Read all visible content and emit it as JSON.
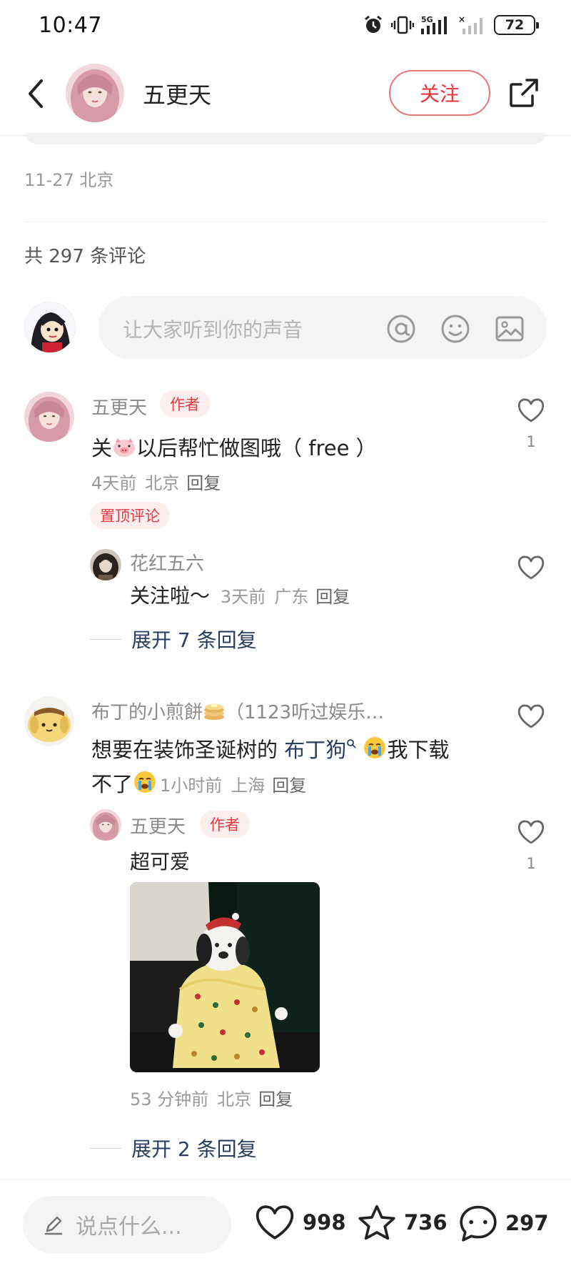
{
  "status_bar": {
    "time": "10:47",
    "battery": "72",
    "network": "5G"
  },
  "nav": {
    "title": "五更天",
    "follow_label": "关注"
  },
  "post": {
    "meta": "11-27 北京",
    "comment_count": "共 297 条评论"
  },
  "input": {
    "placeholder": "让大家听到你的声音"
  },
  "comments": [
    {
      "name": "五更天",
      "tag": "作者",
      "text_a": "关",
      "text_b": "以后帮忙做图哦（ free ）",
      "time": "4天前",
      "location": "北京",
      "reply": "回复",
      "pin_label": "置顶评论",
      "likes": "1",
      "replies": [
        {
          "name": "花红五六",
          "text": "关注啦～",
          "time": "3天前",
          "location": "广东",
          "reply": "回复"
        }
      ],
      "expand_label": "展开 7 条回复"
    },
    {
      "name": "布丁的小煎餅",
      "name_suffix": "（1123听过娱乐…",
      "text_a": "想要在装饰圣诞树的 ",
      "link": "布丁狗",
      "text_b": "我下载",
      "text_c": "不了",
      "time": "1小时前",
      "location": "上海",
      "reply": "回复",
      "replies": [
        {
          "name": "五更天",
          "tag": "作者",
          "text": "超可爱",
          "time": "53 分钟前",
          "location": "北京",
          "reply": "回复",
          "likes": "1"
        }
      ],
      "expand_label": "展开 2 条回复"
    }
  ],
  "bottom_bar": {
    "placeholder": "说点什么...",
    "likes": "998",
    "stars": "736",
    "comments": "297"
  },
  "colors": {
    "accent": "#e33a44",
    "link": "#2a3e63",
    "tag_bg": "#fdeeee"
  }
}
